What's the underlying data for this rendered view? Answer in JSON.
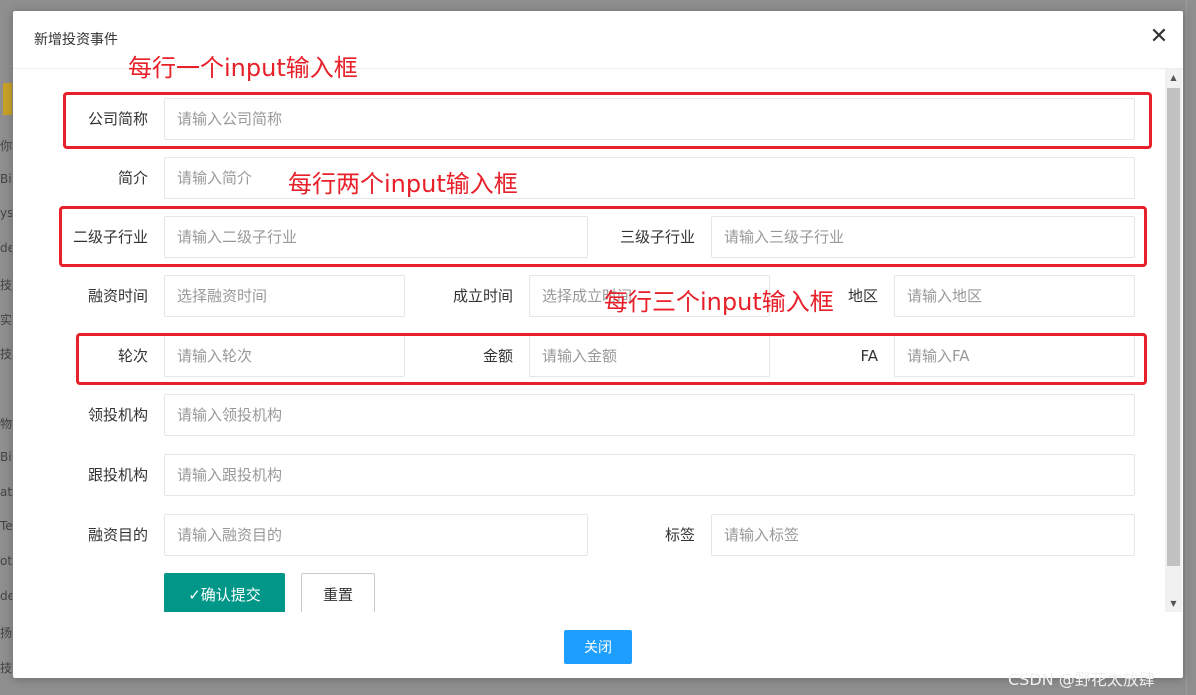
{
  "modal": {
    "title": "新增投资事件",
    "close_icon": "close-icon",
    "close_glyph": "✕"
  },
  "form": {
    "company_name": {
      "label": "公司简称",
      "placeholder": "请输入公司简称"
    },
    "intro": {
      "label": "简介",
      "placeholder": "请输入简介"
    },
    "sub_industry_2": {
      "label": "二级子行业",
      "placeholder": "请输入二级子行业"
    },
    "sub_industry_3": {
      "label": "三级子行业",
      "placeholder": "请输入三级子行业"
    },
    "financing_time": {
      "label": "融资时间",
      "placeholder": "选择融资时间"
    },
    "founded_time": {
      "label": "成立时间",
      "placeholder": "选择成立时间"
    },
    "region": {
      "label": "地区",
      "placeholder": "请输入地区"
    },
    "round": {
      "label": "轮次",
      "placeholder": "请输入轮次"
    },
    "amount": {
      "label": "金额",
      "placeholder": "请输入金额"
    },
    "fa": {
      "label": "FA",
      "placeholder": "请输入FA"
    },
    "lead_investor": {
      "label": "领投机构",
      "placeholder": "请输入领投机构"
    },
    "follow_investor": {
      "label": "跟投机构",
      "placeholder": "请输入跟投机构"
    },
    "purpose": {
      "label": "融资目的",
      "placeholder": "请输入融资目的"
    },
    "tags": {
      "label": "标签",
      "placeholder": "请输入标签"
    }
  },
  "buttons": {
    "submit": "✓确认提交",
    "reset": "重置",
    "close": "关闭"
  },
  "annotations": {
    "one_per_row": "每行一个input输入框",
    "two_per_row": "每行两个input输入框",
    "three_per_row": "每行三个input输入框"
  },
  "background_fragments": [
    "你",
    "Bi",
    "ys",
    "de",
    "技",
    "实践",
    "技",
    "物",
    "Bi",
    "ata",
    "Tes",
    "ot",
    "de",
    "扬",
    "技"
  ],
  "watermark": "CSDN @野花太放肆",
  "colors": {
    "primary_green": "#009688",
    "close_blue": "#1e9fff",
    "annotation_red": "#e8202a"
  }
}
